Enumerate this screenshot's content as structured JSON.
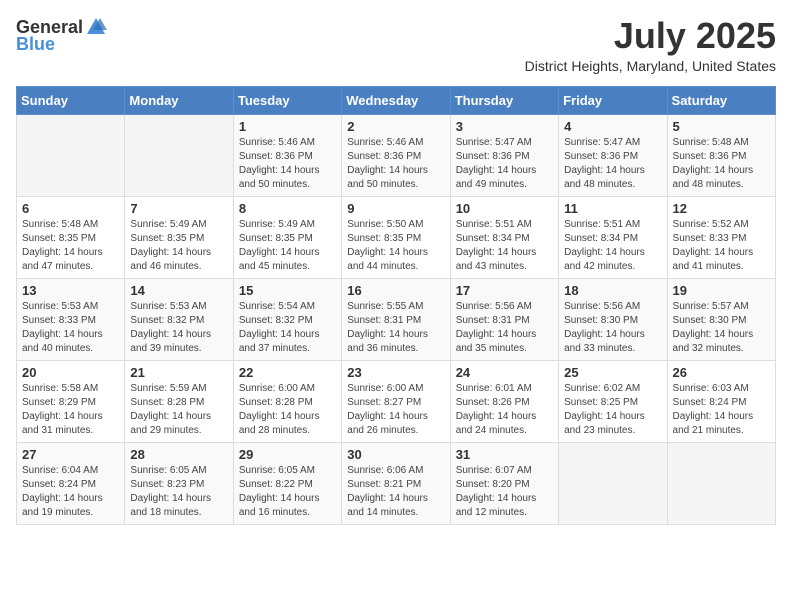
{
  "header": {
    "logo_general": "General",
    "logo_blue": "Blue",
    "month_year": "July 2025",
    "location": "District Heights, Maryland, United States"
  },
  "weekdays": [
    "Sunday",
    "Monday",
    "Tuesday",
    "Wednesday",
    "Thursday",
    "Friday",
    "Saturday"
  ],
  "weeks": [
    [
      {
        "day": "",
        "sunrise": "",
        "sunset": "",
        "daylight": ""
      },
      {
        "day": "",
        "sunrise": "",
        "sunset": "",
        "daylight": ""
      },
      {
        "day": "1",
        "sunrise": "Sunrise: 5:46 AM",
        "sunset": "Sunset: 8:36 PM",
        "daylight": "Daylight: 14 hours and 50 minutes."
      },
      {
        "day": "2",
        "sunrise": "Sunrise: 5:46 AM",
        "sunset": "Sunset: 8:36 PM",
        "daylight": "Daylight: 14 hours and 50 minutes."
      },
      {
        "day": "3",
        "sunrise": "Sunrise: 5:47 AM",
        "sunset": "Sunset: 8:36 PM",
        "daylight": "Daylight: 14 hours and 49 minutes."
      },
      {
        "day": "4",
        "sunrise": "Sunrise: 5:47 AM",
        "sunset": "Sunset: 8:36 PM",
        "daylight": "Daylight: 14 hours and 48 minutes."
      },
      {
        "day": "5",
        "sunrise": "Sunrise: 5:48 AM",
        "sunset": "Sunset: 8:36 PM",
        "daylight": "Daylight: 14 hours and 48 minutes."
      }
    ],
    [
      {
        "day": "6",
        "sunrise": "Sunrise: 5:48 AM",
        "sunset": "Sunset: 8:35 PM",
        "daylight": "Daylight: 14 hours and 47 minutes."
      },
      {
        "day": "7",
        "sunrise": "Sunrise: 5:49 AM",
        "sunset": "Sunset: 8:35 PM",
        "daylight": "Daylight: 14 hours and 46 minutes."
      },
      {
        "day": "8",
        "sunrise": "Sunrise: 5:49 AM",
        "sunset": "Sunset: 8:35 PM",
        "daylight": "Daylight: 14 hours and 45 minutes."
      },
      {
        "day": "9",
        "sunrise": "Sunrise: 5:50 AM",
        "sunset": "Sunset: 8:35 PM",
        "daylight": "Daylight: 14 hours and 44 minutes."
      },
      {
        "day": "10",
        "sunrise": "Sunrise: 5:51 AM",
        "sunset": "Sunset: 8:34 PM",
        "daylight": "Daylight: 14 hours and 43 minutes."
      },
      {
        "day": "11",
        "sunrise": "Sunrise: 5:51 AM",
        "sunset": "Sunset: 8:34 PM",
        "daylight": "Daylight: 14 hours and 42 minutes."
      },
      {
        "day": "12",
        "sunrise": "Sunrise: 5:52 AM",
        "sunset": "Sunset: 8:33 PM",
        "daylight": "Daylight: 14 hours and 41 minutes."
      }
    ],
    [
      {
        "day": "13",
        "sunrise": "Sunrise: 5:53 AM",
        "sunset": "Sunset: 8:33 PM",
        "daylight": "Daylight: 14 hours and 40 minutes."
      },
      {
        "day": "14",
        "sunrise": "Sunrise: 5:53 AM",
        "sunset": "Sunset: 8:32 PM",
        "daylight": "Daylight: 14 hours and 39 minutes."
      },
      {
        "day": "15",
        "sunrise": "Sunrise: 5:54 AM",
        "sunset": "Sunset: 8:32 PM",
        "daylight": "Daylight: 14 hours and 37 minutes."
      },
      {
        "day": "16",
        "sunrise": "Sunrise: 5:55 AM",
        "sunset": "Sunset: 8:31 PM",
        "daylight": "Daylight: 14 hours and 36 minutes."
      },
      {
        "day": "17",
        "sunrise": "Sunrise: 5:56 AM",
        "sunset": "Sunset: 8:31 PM",
        "daylight": "Daylight: 14 hours and 35 minutes."
      },
      {
        "day": "18",
        "sunrise": "Sunrise: 5:56 AM",
        "sunset": "Sunset: 8:30 PM",
        "daylight": "Daylight: 14 hours and 33 minutes."
      },
      {
        "day": "19",
        "sunrise": "Sunrise: 5:57 AM",
        "sunset": "Sunset: 8:30 PM",
        "daylight": "Daylight: 14 hours and 32 minutes."
      }
    ],
    [
      {
        "day": "20",
        "sunrise": "Sunrise: 5:58 AM",
        "sunset": "Sunset: 8:29 PM",
        "daylight": "Daylight: 14 hours and 31 minutes."
      },
      {
        "day": "21",
        "sunrise": "Sunrise: 5:59 AM",
        "sunset": "Sunset: 8:28 PM",
        "daylight": "Daylight: 14 hours and 29 minutes."
      },
      {
        "day": "22",
        "sunrise": "Sunrise: 6:00 AM",
        "sunset": "Sunset: 8:28 PM",
        "daylight": "Daylight: 14 hours and 28 minutes."
      },
      {
        "day": "23",
        "sunrise": "Sunrise: 6:00 AM",
        "sunset": "Sunset: 8:27 PM",
        "daylight": "Daylight: 14 hours and 26 minutes."
      },
      {
        "day": "24",
        "sunrise": "Sunrise: 6:01 AM",
        "sunset": "Sunset: 8:26 PM",
        "daylight": "Daylight: 14 hours and 24 minutes."
      },
      {
        "day": "25",
        "sunrise": "Sunrise: 6:02 AM",
        "sunset": "Sunset: 8:25 PM",
        "daylight": "Daylight: 14 hours and 23 minutes."
      },
      {
        "day": "26",
        "sunrise": "Sunrise: 6:03 AM",
        "sunset": "Sunset: 8:24 PM",
        "daylight": "Daylight: 14 hours and 21 minutes."
      }
    ],
    [
      {
        "day": "27",
        "sunrise": "Sunrise: 6:04 AM",
        "sunset": "Sunset: 8:24 PM",
        "daylight": "Daylight: 14 hours and 19 minutes."
      },
      {
        "day": "28",
        "sunrise": "Sunrise: 6:05 AM",
        "sunset": "Sunset: 8:23 PM",
        "daylight": "Daylight: 14 hours and 18 minutes."
      },
      {
        "day": "29",
        "sunrise": "Sunrise: 6:05 AM",
        "sunset": "Sunset: 8:22 PM",
        "daylight": "Daylight: 14 hours and 16 minutes."
      },
      {
        "day": "30",
        "sunrise": "Sunrise: 6:06 AM",
        "sunset": "Sunset: 8:21 PM",
        "daylight": "Daylight: 14 hours and 14 minutes."
      },
      {
        "day": "31",
        "sunrise": "Sunrise: 6:07 AM",
        "sunset": "Sunset: 8:20 PM",
        "daylight": "Daylight: 14 hours and 12 minutes."
      },
      {
        "day": "",
        "sunrise": "",
        "sunset": "",
        "daylight": ""
      },
      {
        "day": "",
        "sunrise": "",
        "sunset": "",
        "daylight": ""
      }
    ]
  ]
}
